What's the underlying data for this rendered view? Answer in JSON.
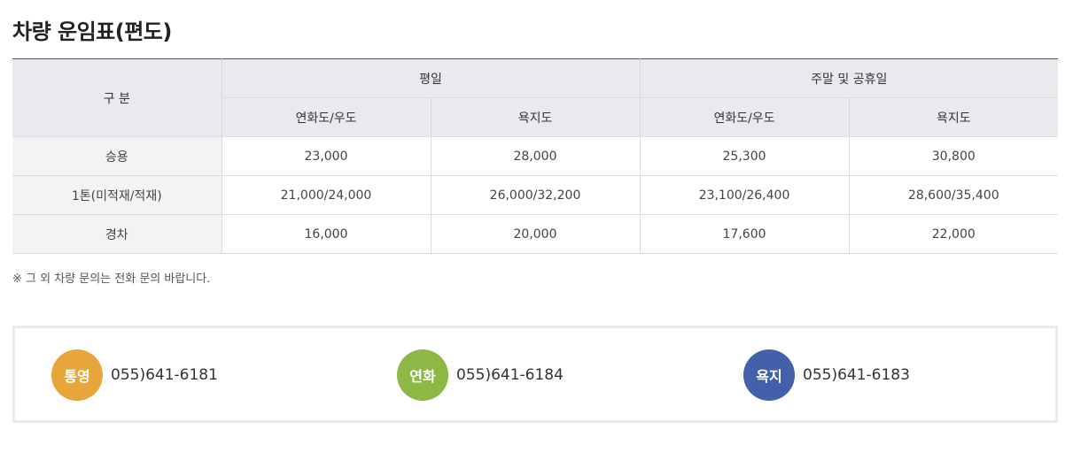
{
  "title": "차량 운임표(편도)",
  "table": {
    "category_header": "구 분",
    "groups": [
      {
        "label": "평일",
        "sub": [
          "연화도/우도",
          "욕지도"
        ]
      },
      {
        "label": "주말 및 공휴일",
        "sub": [
          "연화도/우도",
          "욕지도"
        ]
      }
    ],
    "rows": [
      {
        "label": "승용",
        "values": [
          "23,000",
          "28,000",
          "25,300",
          "30,800"
        ]
      },
      {
        "label": "1톤(미적재/적재)",
        "values": [
          "21,000/24,000",
          "26,000/32,200",
          "23,100/26,400",
          "28,600/35,400"
        ]
      },
      {
        "label": "경차",
        "values": [
          "16,000",
          "20,000",
          "17,600",
          "22,000"
        ]
      }
    ]
  },
  "note": "※ 그 외 차량 문의는 전화 문의 바랍니다.",
  "contacts": [
    {
      "badge": "통영",
      "phone": "055)641-6181",
      "color": "#e8a63a"
    },
    {
      "badge": "연화",
      "phone": "055)641-6184",
      "color": "#8db843"
    },
    {
      "badge": "욕지",
      "phone": "055)641-6183",
      "color": "#4560ab"
    }
  ]
}
